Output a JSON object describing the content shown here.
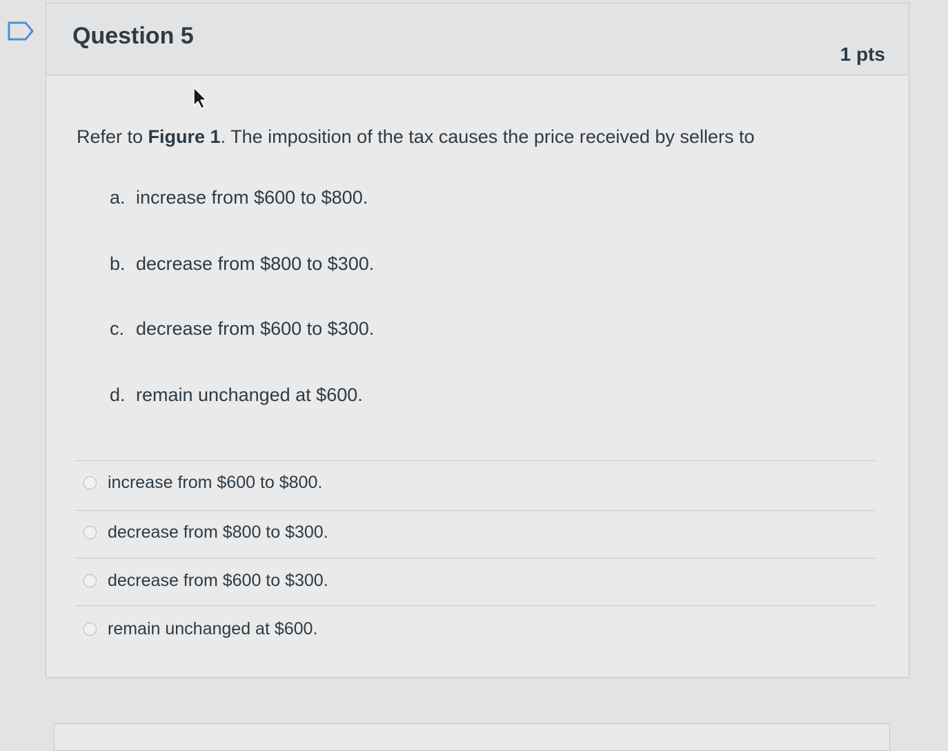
{
  "question": {
    "title": "Question 5",
    "points": "1 pts",
    "text_prefix": "Refer to ",
    "figure_ref": "Figure 1",
    "text_suffix": ". The imposition of the tax causes the price received by sellers to",
    "options": [
      {
        "letter": "a.",
        "text": "increase from $600 to $800."
      },
      {
        "letter": "b.",
        "text": "decrease from $800 to $300."
      },
      {
        "letter": "c.",
        "text": "decrease from $600 to $300."
      },
      {
        "letter": "d.",
        "text": "remain unchanged at $600."
      }
    ],
    "answers": [
      {
        "label": "increase from $600 to $800.",
        "selected": false
      },
      {
        "label": "decrease from $800 to $300.",
        "selected": false
      },
      {
        "label": "decrease from $600 to $300.",
        "selected": false
      },
      {
        "label": "remain unchanged at $600.",
        "selected": false
      }
    ]
  },
  "icons": {
    "flag": "flag-outline-icon",
    "cursor": "mouse-pointer-icon"
  },
  "colors": {
    "text": "#2d3b45",
    "background": "#e3e3e4",
    "border": "#c4c6c8",
    "flag": "#4a90d9"
  }
}
